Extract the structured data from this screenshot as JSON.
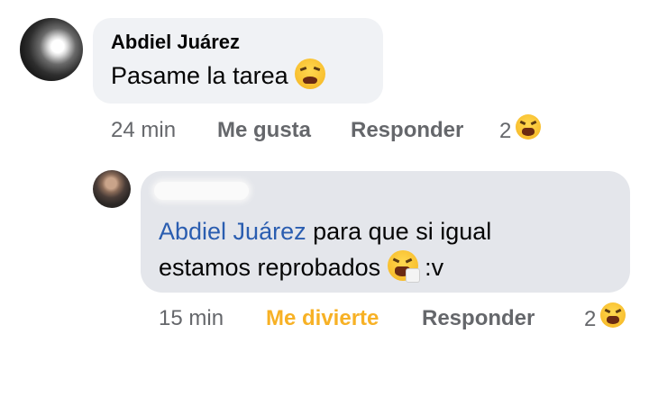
{
  "comment": {
    "author": "Abdiel Juárez",
    "text": "Pasame la tarea",
    "emoji": "weary-face-emoji",
    "time": "24 min",
    "like_label": "Me gusta",
    "reply_label": "Responder",
    "reaction_count": "2",
    "reaction_icon": "laughing-emoji"
  },
  "reply": {
    "author": "",
    "mention": "Abdiel Juárez",
    "text_part1": " para que si igual",
    "text_part2": "estamos reprobados",
    "emoji": "sneezing-face-emoji",
    "text_suffix": " :v",
    "time": "15 min",
    "reaction_label": "Me divierte",
    "reaction_label_color": "#f7b125",
    "reply_label": "Responder",
    "reaction_count": "2",
    "reaction_icon": "laughing-emoji"
  }
}
